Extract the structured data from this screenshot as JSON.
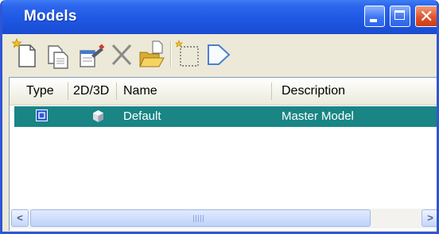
{
  "window": {
    "title": "Models",
    "controls": {
      "minimize": "minimize",
      "maximize": "maximize",
      "close": "close"
    }
  },
  "toolbar": {
    "items": [
      {
        "name": "new-model",
        "icon": "new-document-icon"
      },
      {
        "name": "copy-model",
        "icon": "copy-document-icon"
      },
      {
        "name": "edit-properties",
        "icon": "properties-icon"
      },
      {
        "name": "delete-model",
        "icon": "delete-x-icon"
      },
      {
        "name": "import-model",
        "icon": "open-folder-icon"
      },
      {
        "name": "create-sheet",
        "icon": "dotted-rectangle-icon"
      },
      {
        "name": "set-active",
        "icon": "arrow-shape-icon"
      }
    ]
  },
  "table": {
    "columns": [
      "Type",
      "2D/3D",
      "Name",
      "Description"
    ],
    "rows": [
      {
        "type_icon": "design-model-icon",
        "dimension_icon": "3d-cube-icon",
        "name": "Default",
        "description": "Master Model",
        "selected": true
      }
    ]
  },
  "colors": {
    "titlebar": "#2062e5",
    "selection": "#198585",
    "window_bg": "#ece9d8"
  }
}
